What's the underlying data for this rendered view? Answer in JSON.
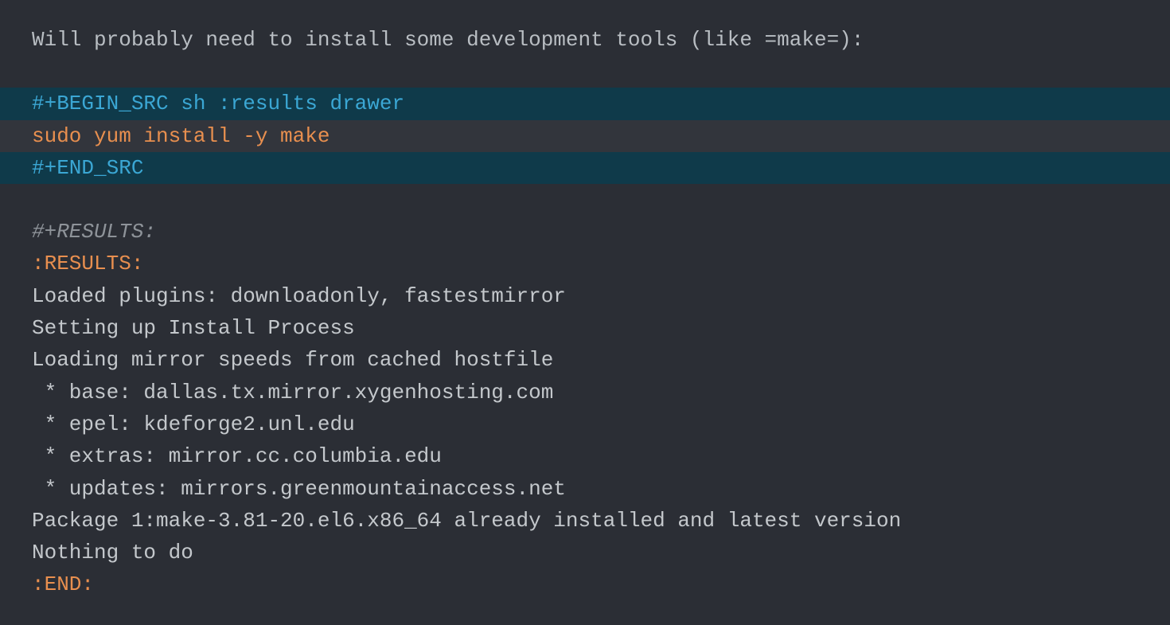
{
  "intro": "Will probably need to install some development tools (like =make=):",
  "src": {
    "begin": "#+BEGIN_SRC sh :results drawer",
    "code": "sudo yum install -y make",
    "end": "#+END_SRC"
  },
  "results": {
    "header": "#+RESULTS:",
    "drawer_open": ":RESULTS:",
    "output": [
      "Loaded plugins: downloadonly, fastestmirror",
      "Setting up Install Process",
      "Loading mirror speeds from cached hostfile",
      " * base: dallas.tx.mirror.xygenhosting.com",
      " * epel: kdeforge2.unl.edu",
      " * extras: mirror.cc.columbia.edu",
      " * updates: mirrors.greenmountainaccess.net",
      "Package 1:make-3.81-20.el6.x86_64 already installed and latest version",
      "Nothing to do"
    ],
    "drawer_close": ":END:"
  }
}
